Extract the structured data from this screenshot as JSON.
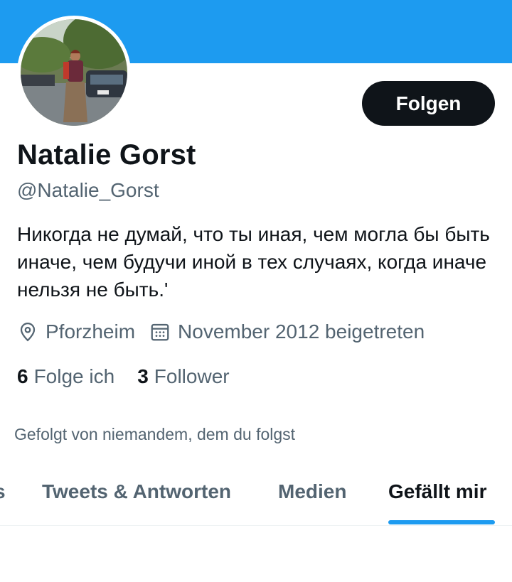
{
  "colors": {
    "banner": "#1d9bf0",
    "primary_text": "#0f1419",
    "secondary_text": "#536471",
    "accent": "#1d9bf0"
  },
  "profile": {
    "name": "Natalie Gorst",
    "handle": "@Natalie_Gorst",
    "bio": "Никогда не думай, что ты иная, чем могла бы быть иначе, чем будучи иной в тех случаях, когда иначе нельзя не быть.'",
    "avatar_icon": "avatar-photo",
    "location": "Pforzheim",
    "joined": "November 2012 beigetreten",
    "location_icon": "location-pin-icon",
    "joined_icon": "calendar-icon"
  },
  "actions": {
    "follow_label": "Folgen"
  },
  "stats": {
    "following_count": "6",
    "following_label": "Folge ich",
    "followers_count": "3",
    "followers_label": "Follower"
  },
  "followed_by": "Gefolgt von niemandem, dem du folgst",
  "tabs": [
    {
      "label": "s",
      "active": false
    },
    {
      "label": "Tweets & Antworten",
      "active": false
    },
    {
      "label": "Medien",
      "active": false
    },
    {
      "label": "Gefällt mir",
      "active": true
    }
  ]
}
